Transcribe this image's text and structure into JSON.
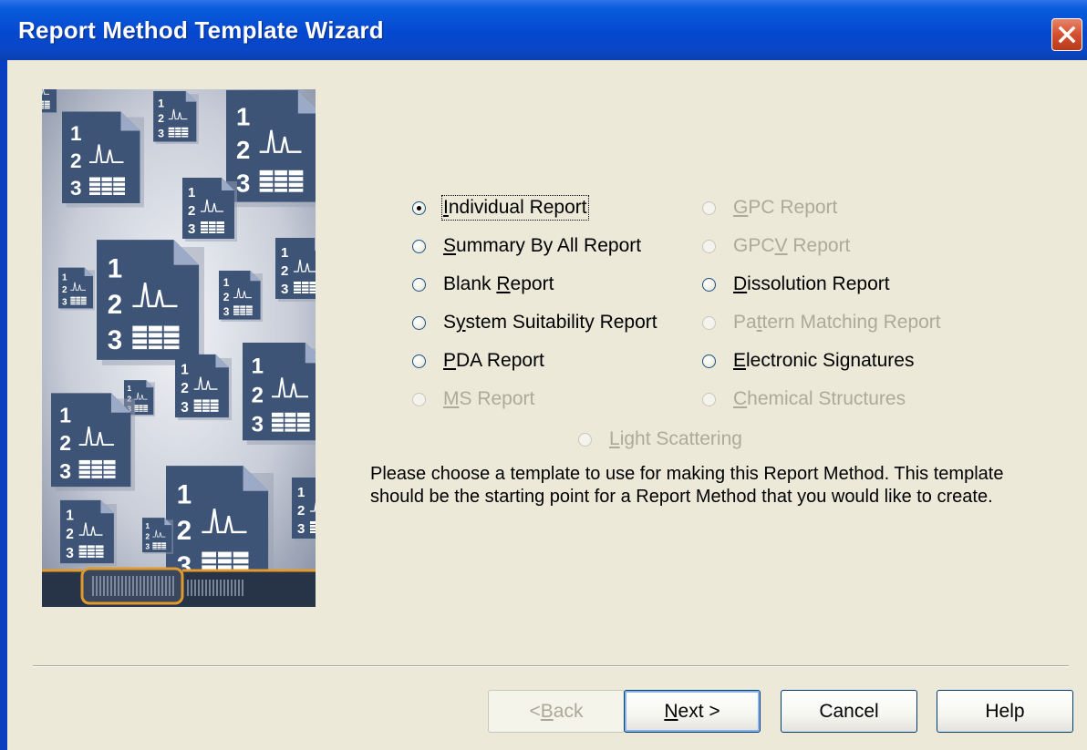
{
  "window": {
    "title": "Report Method Template Wizard"
  },
  "options": [
    {
      "pre": "",
      "key": "I",
      "post": "ndividual Report",
      "checked": true,
      "enabled": true
    },
    {
      "pre": "",
      "key": "S",
      "post": "ummary By All Report",
      "checked": false,
      "enabled": true
    },
    {
      "pre": "Blank ",
      "key": "R",
      "post": "eport",
      "checked": false,
      "enabled": true
    },
    {
      "pre": "S",
      "key": "y",
      "post": "stem Suitability Report",
      "checked": false,
      "enabled": true
    },
    {
      "pre": "",
      "key": "P",
      "post": "DA Report",
      "checked": false,
      "enabled": true
    },
    {
      "pre": "",
      "key": "M",
      "post": "S Report",
      "checked": false,
      "enabled": false
    },
    {
      "pre": "",
      "key": "G",
      "post": "PC Report",
      "checked": false,
      "enabled": false
    },
    {
      "pre": "GPC",
      "key": "V",
      "post": " Report",
      "checked": false,
      "enabled": false
    },
    {
      "pre": "",
      "key": "D",
      "post": "issolution Report",
      "checked": false,
      "enabled": true
    },
    {
      "pre": "Pa",
      "key": "t",
      "post": "tern Matching Report",
      "checked": false,
      "enabled": false
    },
    {
      "pre": "",
      "key": "E",
      "post": "lectronic Signatures",
      "checked": false,
      "enabled": true
    },
    {
      "pre": "",
      "key": "C",
      "post": "hemical Structures",
      "checked": false,
      "enabled": false
    },
    {
      "pre": "",
      "key": "L",
      "post": "ight Scattering",
      "checked": false,
      "enabled": false
    }
  ],
  "description": "Please choose a template to use for making this Report Method.  This template should be the starting point for a Report Method that you would like to create.",
  "buttons": {
    "back": {
      "pre": "< ",
      "key": "B",
      "post": "ack",
      "enabled": false
    },
    "next": {
      "pre": "",
      "key": "N",
      "post": "ext >",
      "enabled": true
    },
    "cancel": {
      "label": "Cancel"
    },
    "help": {
      "label": "Help"
    }
  },
  "colors": {
    "title_bar": "#0548D0",
    "face": "#ECE9D8",
    "disabled_text": "#ADAA9C",
    "illustration": "#3E5477"
  }
}
